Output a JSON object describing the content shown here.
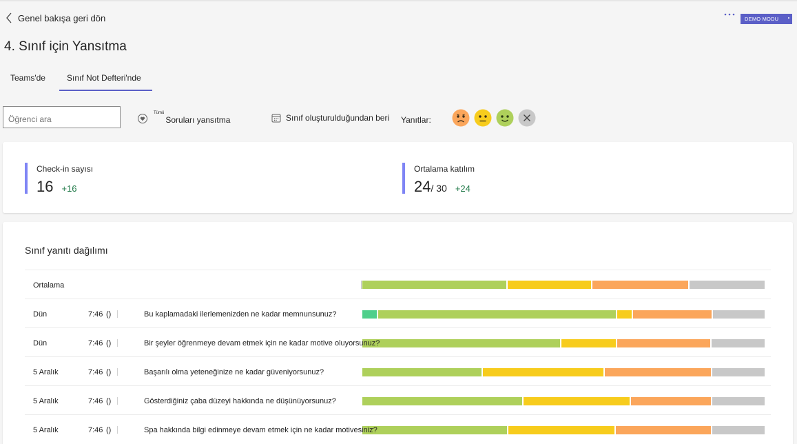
{
  "header": {
    "back_label": "Genel bakışa geri dön",
    "demo_label": "DEMO MODU",
    "title": "4. Sınıf için Yansıtma"
  },
  "tabs": [
    {
      "label": "Teams'de",
      "selected": false
    },
    {
      "label": "Sınıf Not Defteri'nde",
      "selected": true
    }
  ],
  "filters": {
    "search_placeholder": "Öğrenci ara",
    "questions_sup": "Tümü",
    "questions_label": "Soruları yansıtma",
    "date_label": "Sınıf oluşturulduğundan beri",
    "responses_label": "Yanıtlar:"
  },
  "stats": {
    "checkins": {
      "label": "Check-in sayısı",
      "value": "16",
      "delta": "+16"
    },
    "participation": {
      "label": "Ortalama katılım",
      "value": "24",
      "total": "/ 30",
      "delta": "+24"
    }
  },
  "distribution": {
    "title": "Sınıf yanıtı dağılımı",
    "colors": {
      "very_positive": "#4fcf8b",
      "positive": "#aed05b",
      "neutral": "#f7cc1d",
      "negative": "#fba65b",
      "no_response": "#c8c8c8"
    },
    "average": {
      "label": "Ortalama",
      "segments": [
        {
          "type": "positive",
          "percent": 36.2
        },
        {
          "type": "neutral",
          "percent": 20.9
        },
        {
          "type": "negative",
          "percent": 24.1
        },
        {
          "type": "no_response",
          "percent": 18.8
        }
      ]
    },
    "rows": [
      {
        "date": "Dün",
        "time": "7:46",
        "paren": "()",
        "question": "Bu kaplamadaki ilerlemenizden ne kadar memnunsunuz?",
        "segments": [
          {
            "type": "very_positive",
            "percent": 3.7
          },
          {
            "type": "positive",
            "percent": 59.9
          },
          {
            "type": "neutral",
            "percent": 3.6
          },
          {
            "type": "negative",
            "percent": 19.8
          },
          {
            "type": "no_response",
            "percent": 13.0
          }
        ]
      },
      {
        "date": "Dün",
        "time": "7:46",
        "paren": "()",
        "question": "Bir şeyler öğrenmeye devam etmek için ne kadar motive oluyorsunuz?",
        "segments": [
          {
            "type": "positive",
            "percent": 49.7
          },
          {
            "type": "neutral",
            "percent": 13.7
          },
          {
            "type": "negative",
            "percent": 23.3
          },
          {
            "type": "no_response",
            "percent": 13.3
          }
        ]
      },
      {
        "date": "5 Aralık",
        "time": "7:46",
        "paren": "()",
        "question": "Başarılı olma yeteneğinize ne kadar güveniyorsunuz?",
        "segments": [
          {
            "type": "positive",
            "percent": 30.0
          },
          {
            "type": "neutral",
            "percent": 30.2
          },
          {
            "type": "negative",
            "percent": 26.6
          },
          {
            "type": "no_response",
            "percent": 13.2
          }
        ]
      },
      {
        "date": "5 Aralık",
        "time": "7:46",
        "paren": "()",
        "question": "Gösterdiğiniz çaba düzeyi hakkında ne düşünüyorsunuz?",
        "segments": [
          {
            "type": "positive",
            "percent": 40.1
          },
          {
            "type": "neutral",
            "percent": 26.6
          },
          {
            "type": "negative",
            "percent": 20.2
          },
          {
            "type": "no_response",
            "percent": 13.1
          }
        ]
      },
      {
        "date": "5 Aralık",
        "time": "7:46",
        "paren": "()",
        "question": "Spa hakkında bilgi edinmeye devam etmek için ne kadar motivesiniz?",
        "segments": [
          {
            "type": "positive",
            "percent": 36.3
          },
          {
            "type": "neutral",
            "percent": 26.7
          },
          {
            "type": "negative",
            "percent": 23.8
          },
          {
            "type": "no_response",
            "percent": 13.2
          }
        ]
      }
    ]
  }
}
